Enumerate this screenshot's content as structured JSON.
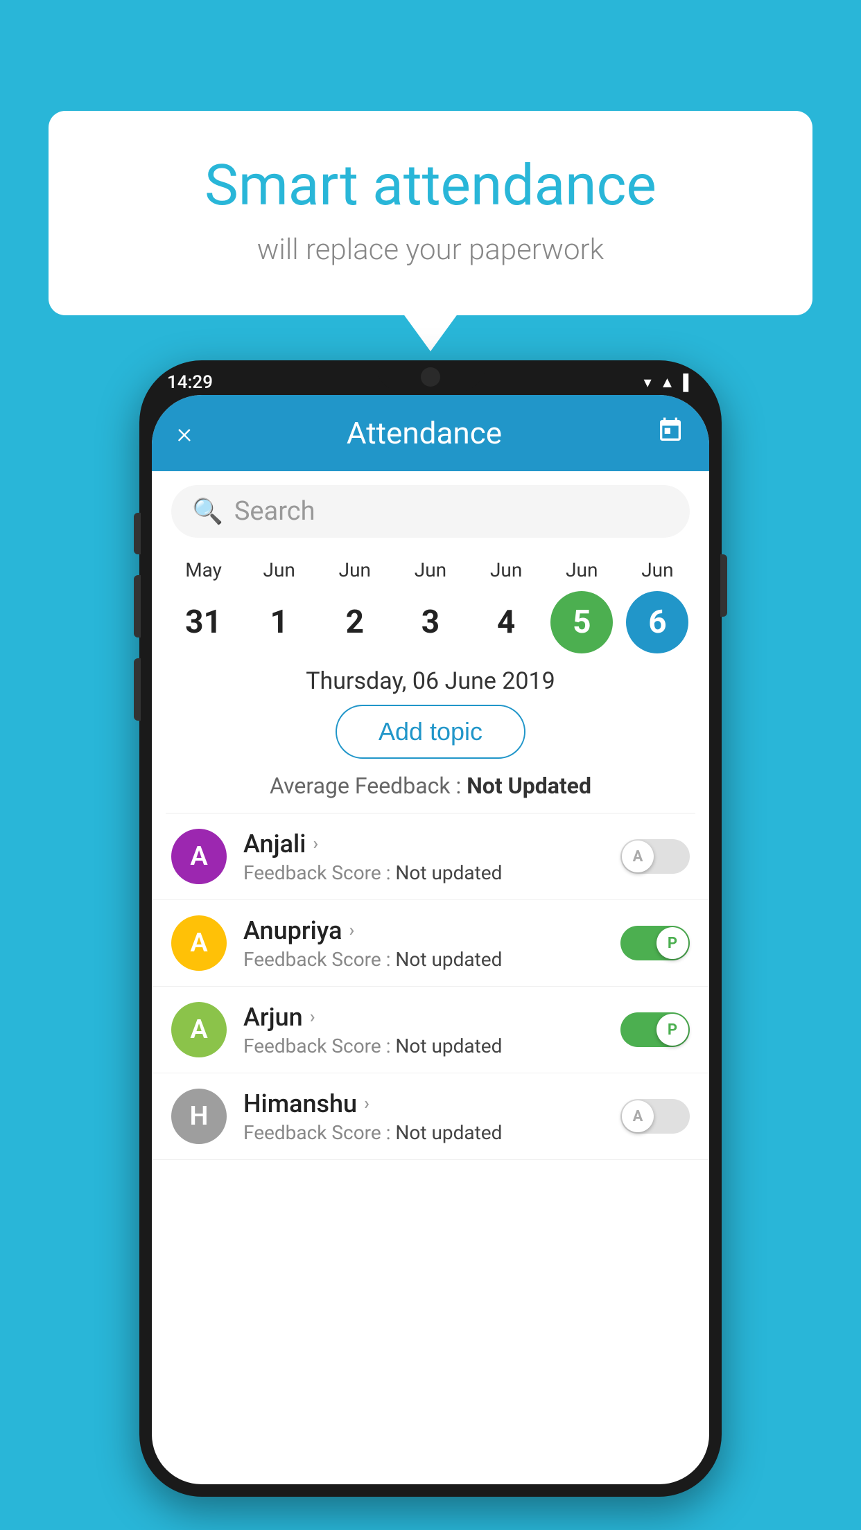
{
  "background_color": "#29B6D8",
  "speech_bubble": {
    "title": "Smart attendance",
    "subtitle": "will replace your paperwork"
  },
  "status_bar": {
    "time": "14:29",
    "icons": [
      "wifi",
      "signal",
      "battery"
    ]
  },
  "app_header": {
    "close_label": "×",
    "title": "Attendance",
    "calendar_icon": "📅"
  },
  "search": {
    "placeholder": "Search"
  },
  "calendar": {
    "days": [
      {
        "month": "May",
        "number": "31",
        "state": "normal"
      },
      {
        "month": "Jun",
        "number": "1",
        "state": "normal"
      },
      {
        "month": "Jun",
        "number": "2",
        "state": "normal"
      },
      {
        "month": "Jun",
        "number": "3",
        "state": "normal"
      },
      {
        "month": "Jun",
        "number": "4",
        "state": "normal"
      },
      {
        "month": "Jun",
        "number": "5",
        "state": "today"
      },
      {
        "month": "Jun",
        "number": "6",
        "state": "selected"
      }
    ]
  },
  "selected_date": "Thursday, 06 June 2019",
  "add_topic_label": "Add topic",
  "avg_feedback_label": "Average Feedback : ",
  "avg_feedback_value": "Not Updated",
  "students": [
    {
      "name": "Anjali",
      "avatar_letter": "A",
      "avatar_color": "#9C27B0",
      "feedback_label": "Feedback Score : ",
      "feedback_value": "Not updated",
      "toggle": "off",
      "toggle_letter": "A"
    },
    {
      "name": "Anupriya",
      "avatar_letter": "A",
      "avatar_color": "#FFC107",
      "feedback_label": "Feedback Score : ",
      "feedback_value": "Not updated",
      "toggle": "on",
      "toggle_letter": "P"
    },
    {
      "name": "Arjun",
      "avatar_letter": "A",
      "avatar_color": "#8BC34A",
      "feedback_label": "Feedback Score : ",
      "feedback_value": "Not updated",
      "toggle": "on",
      "toggle_letter": "P"
    },
    {
      "name": "Himanshu",
      "avatar_letter": "H",
      "avatar_color": "#9E9E9E",
      "feedback_label": "Feedback Score : ",
      "feedback_value": "Not updated",
      "toggle": "off",
      "toggle_letter": "A"
    }
  ]
}
